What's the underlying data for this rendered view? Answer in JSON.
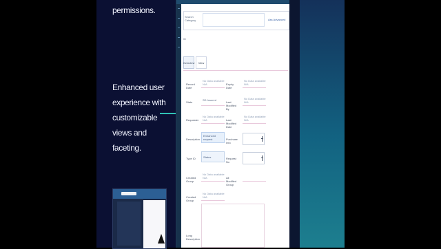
{
  "left_panel": {
    "top_text": "permissions.",
    "main_text": "Enhanced user experience with customizable views and faceting."
  },
  "app": {
    "search_category": "Search Category",
    "advanced_search": "Ass Advanced",
    "code_label": "ID",
    "tabs": [
      {
        "label": "Overview"
      },
      {
        "label": "View"
      }
    ],
    "fields_left": [
      {
        "label": "Record Date",
        "value": "No Data available N/A"
      },
      {
        "label": "State",
        "value": "SD Insured"
      },
      {
        "label": "Requester",
        "value": "No Data available N/A"
      },
      {
        "label": "Description",
        "value": "Enhanced request"
      },
      {
        "label": "Type ID",
        "value": "Status"
      },
      {
        "label": "Created Group",
        "value": "No Data available N/A"
      },
      {
        "label": "Created Group",
        "value": "No Data available N/A"
      },
      {
        "label": "Long Description",
        "value": ""
      }
    ],
    "fields_right": [
      {
        "label": "Expiry Date",
        "value": "No Data available N/A"
      },
      {
        "label": "Last Modified By",
        "value": "No Data available N/A"
      },
      {
        "label": "Last Modified Date",
        "value": "No Data available N/A"
      },
      {
        "label": "Purchase Info",
        "value": ""
      },
      {
        "label": "Request No",
        "value": ""
      },
      {
        "label": "All Modified Group",
        "value": ""
      }
    ]
  }
}
